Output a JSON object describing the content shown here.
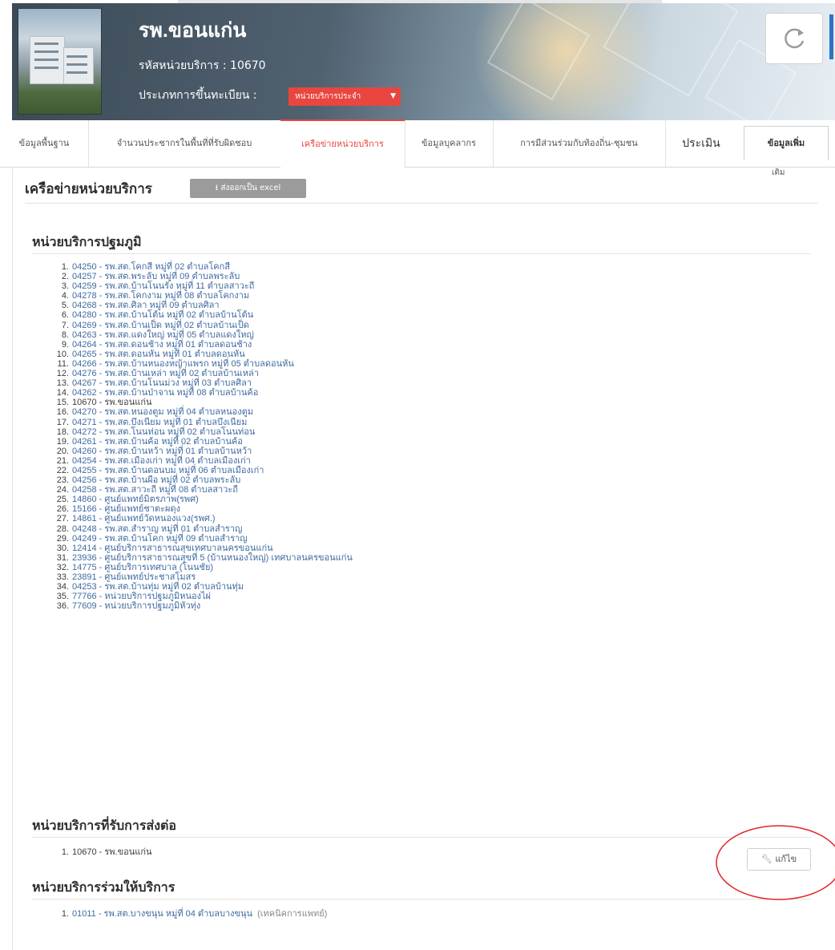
{
  "header": {
    "hospital_name": "รพ.ขอนแก่น",
    "service_code_label": "รหัสหน่วยบริการ : 10670",
    "registration_type_label": "ประเภทการขึ้นทะเบียน :",
    "registration_type_value": "หน่วยบริการประจำ"
  },
  "tabs": [
    {
      "label": "ข้อมูลพื้นฐาน"
    },
    {
      "label": "จำนวนประชากรในพื้นที่ที่รับผิดชอบ"
    },
    {
      "label": "เครือข่ายหน่วยบริการ"
    },
    {
      "label": "ข้อมูลบุคลากร"
    },
    {
      "label": "การมีส่วนร่วมกับท้องถิ่น-ชุมชน"
    },
    {
      "label": "ประเมิน"
    },
    {
      "label": "ข้อมูลเพิ่ม",
      "label_wrap": "เติม"
    }
  ],
  "page": {
    "title": "เครือข่ายหน่วยบริการ",
    "export_button": "ส่งออกเป็น excel"
  },
  "primary_care": {
    "heading": "หน่วยบริการปฐมภูมิ",
    "items": [
      {
        "num": "1.",
        "text": "04250 - รพ.สต.โคกสี หมู่ที่ 02 ตำบลโคกสี"
      },
      {
        "num": "2.",
        "text": "04257 - รพ.สต.พระลับ หมู่ที่ 09 ตำบลพระลับ"
      },
      {
        "num": "3.",
        "text": "04259 - รพ.สต.บ้านโนนรัง หมู่ที่ 11 ตำบลสาวะถี"
      },
      {
        "num": "4.",
        "text": "04278 - รพ.สต.โคกงาม หมู่ที่ 08 ตำบลโคกงาม"
      },
      {
        "num": "5.",
        "text": "04268 - รพ.สต.ศิลา หมู่ที่ 09 ตำบลศิลา"
      },
      {
        "num": "6.",
        "text": "04280 - รพ.สต.บ้านโต้น หมู่ที่ 02 ตำบลบ้านโต้น"
      },
      {
        "num": "7.",
        "text": "04269 - รพ.สต.บ้านเป็ด หมู่ที่ 02 ตำบลบ้านเป็ด"
      },
      {
        "num": "8.",
        "text": "04263 - รพ.สต.แดงใหญ่ หมู่ที่ 05 ตำบลแดงใหญ่"
      },
      {
        "num": "9.",
        "text": "04264 - รพ.สต.ดอนช้าง หมู่ที่ 01 ตำบลดอนช้าง"
      },
      {
        "num": "10.",
        "text": "04265 - รพ.สต.ดอนหัน หมู่ที่ 01 ตำบลดอนหัน"
      },
      {
        "num": "11.",
        "text": "04266 - รพ.สต.บ้านหนองหญ้าแพรก หมู่ที่ 05 ตำบลดอนหัน"
      },
      {
        "num": "12.",
        "text": "04276 - รพ.สต.บ้านเหล่า หมู่ที่ 02 ตำบลบ้านเหล่า"
      },
      {
        "num": "13.",
        "text": "04267 - รพ.สต.บ้านโนนม่วง หมู่ที่ 03 ตำบลศิลา"
      },
      {
        "num": "14.",
        "text": "04262 - รพ.สต.บ้านป่าจาน หมู่ที่ 08 ตำบลบ้านค้อ"
      },
      {
        "num": "15.",
        "text": "10670 - รพ.ขอนแก่น",
        "dark": true
      },
      {
        "num": "16.",
        "text": "04270 - รพ.สต.หนองตูม หมู่ที่ 04 ตำบลหนองตูม"
      },
      {
        "num": "17.",
        "text": "04271 - รพ.สต.บึงเนียม หมู่ที่ 01 ตำบลบึงเนียม"
      },
      {
        "num": "18.",
        "text": "04272 - รพ.สต.โนนท่อน หมู่ที่ 02 ตำบลโนนท่อน"
      },
      {
        "num": "19.",
        "text": "04261 - รพ.สต.บ้านค้อ หมู่ที่ 02 ตำบลบ้านค้อ"
      },
      {
        "num": "20.",
        "text": "04260 - รพ.สต.บ้านหว้า หมู่ที่ 01 ตำบลบ้านหว้า"
      },
      {
        "num": "21.",
        "text": "04254 - รพ.สต.เมืองเก่า หมู่ที่ 04 ตำบลเมืองเก่า"
      },
      {
        "num": "22.",
        "text": "04255 - รพ.สต.บ้านดอนบม หมู่ที่ 06 ตำบลเมืองเก่า"
      },
      {
        "num": "23.",
        "text": "04256 - รพ.สต.บ้านผือ หมู่ที่ 02 ตำบลพระลับ"
      },
      {
        "num": "24.",
        "text": "04258 - รพ.สต.สาวะถี หมู่ที่ 08 ตำบลสาวะถี"
      },
      {
        "num": "25.",
        "text": "14860 - ศูนย์แพทย์มิตรภาพ(รพศ)"
      },
      {
        "num": "26.",
        "text": "15166 - ศูนย์แพทย์ชาตะผดุง"
      },
      {
        "num": "27.",
        "text": "14861 - ศูนย์แพทย์วัดหนองแวง(รพศ.)"
      },
      {
        "num": "28.",
        "text": "04248 - รพ.สต.สำราญ หมู่ที่ 01 ตำบลสำราญ"
      },
      {
        "num": "29.",
        "text": "04249 - รพ.สต.บ้านโคก หมู่ที่ 09 ตำบลสำราญ"
      },
      {
        "num": "30.",
        "text": "12414 - ศูนย์บริการสาธารณสุขเทศบาลนครขอนแก่น"
      },
      {
        "num": "31.",
        "text": "23936 - ศูนย์บริการสาธารณสุขที่ 5 (บ้านหนองใหญ่) เทศบาลนครขอนแก่น"
      },
      {
        "num": "32.",
        "text": "14775 - ศูนย์บริการเทศบาล (โนนชัย)"
      },
      {
        "num": "33.",
        "text": "23891 - ศูนย์แพทย์ประชาสโมสร"
      },
      {
        "num": "34.",
        "text": "04253 - รพ.สต.บ้านทุ่ม หมู่ที่ 02 ตำบลบ้านทุ่ม"
      },
      {
        "num": "35.",
        "text": "77766 - หน่วยบริการปฐมภูมิหนองไผ่"
      },
      {
        "num": "36.",
        "text": "77609 - หน่วยบริการปฐมภูมิหัวทุ่ง"
      }
    ]
  },
  "referral": {
    "heading": "หน่วยบริการที่รับการส่งต่อ",
    "items": [
      {
        "num": "1.",
        "text": "10670 - รพ.ขอนแก่น",
        "dark": true
      }
    ]
  },
  "joint": {
    "heading": "หน่วยบริการร่วมให้บริการ",
    "edit_button": "แก้ไข",
    "items": [
      {
        "num": "1.",
        "text": "01011 - รพ.สต.บางขนุน หมู่ที่ 04 ตำบลบางขนุน",
        "note": "(เทคนิคการแพทย์)"
      }
    ]
  },
  "colors": {
    "accent_red": "#e8463f",
    "link_blue": "#3f6aa0",
    "export_gray": "#9b9b9b"
  },
  "icons": [
    "refresh-icon",
    "download-icon",
    "wrench-icon",
    "caret-down-icon"
  ]
}
